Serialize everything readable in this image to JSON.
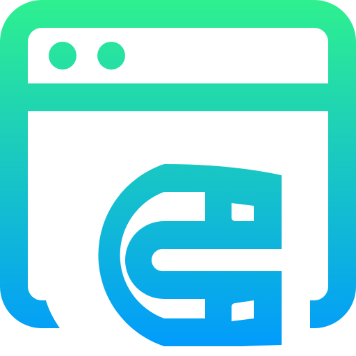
{
  "icon": {
    "name": "browser-magnet-icon",
    "colors": {
      "gradient_top": "#2EF08F",
      "gradient_bottom": "#0099FF",
      "background": "#FFFFFF"
    }
  }
}
